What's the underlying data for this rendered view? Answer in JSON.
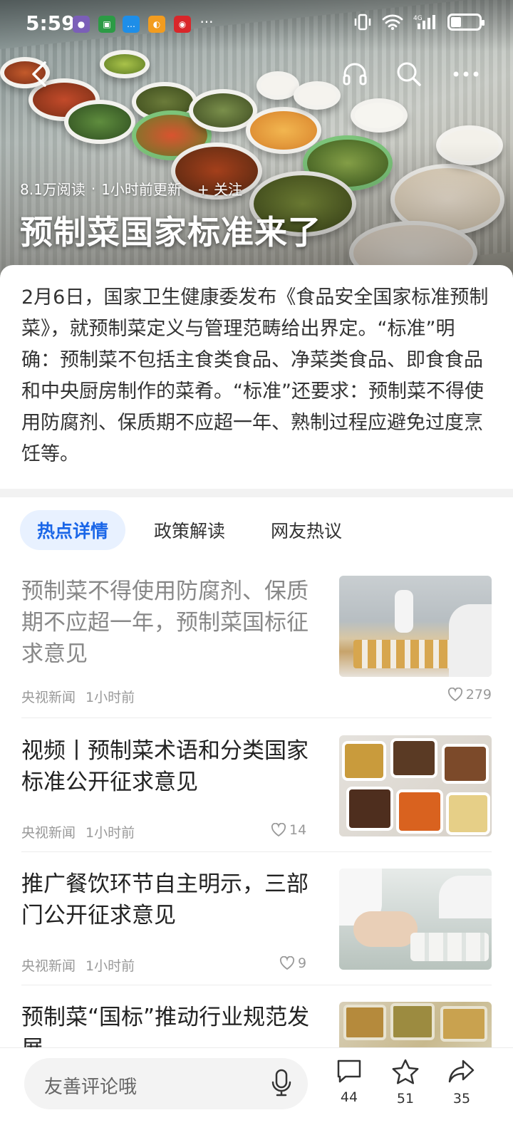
{
  "status_bar": {
    "time": "5:59",
    "more": "···"
  },
  "hero": {
    "reads": "8.1万阅读",
    "dot": "·",
    "updated": "1小时前更新",
    "follow": "+ 关注",
    "title": "预制菜国家标准来了"
  },
  "summary": {
    "text": "2月6日，国家卫生健康委发布《食品安全国家标准预制菜》，就预制菜定义与管理范畴给出界定。“标准”明确：预制菜不包括主食类食品、净菜类食品、即食食品和中央厨房制作的菜肴。“标准”还要求：预制菜不得使用防腐剂、保质期不应超一年、熟制过程应避免过度烹饪等。"
  },
  "tabs": [
    {
      "label": "热点详情",
      "active": true
    },
    {
      "label": "政策解读",
      "active": false
    },
    {
      "label": "网友热议",
      "active": false
    }
  ],
  "news": [
    {
      "title": "预制菜不得使用防腐剂、保质期不应超一年，预制菜国标征求意见",
      "source": "央视新闻",
      "time": "1小时前",
      "likes": "279"
    },
    {
      "title": "视频丨预制菜术语和分类国家标准公开征求意见",
      "source": "央视新闻",
      "time": "1小时前",
      "likes": "14"
    },
    {
      "title": "推广餐饮环节自主明示，三部门公开征求意见",
      "source": "央视新闻",
      "time": "1小时前",
      "likes": "9"
    },
    {
      "title": "预制菜“国标”推动行业规范发展",
      "source": "",
      "time": "",
      "likes": ""
    }
  ],
  "bottom_bar": {
    "comment_placeholder": "友善评论哦",
    "comments": "44",
    "favorites": "51",
    "shares": "35"
  },
  "colors": {
    "accent": "#1a66e8",
    "tab_active_bg": "#e8f1ff"
  }
}
